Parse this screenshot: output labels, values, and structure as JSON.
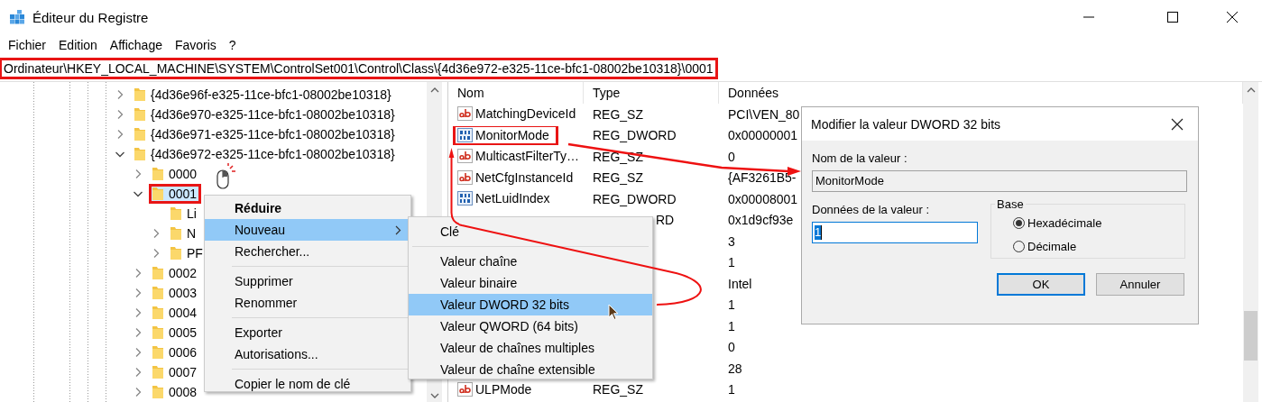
{
  "window": {
    "title": "Éditeur du Registre"
  },
  "menu": [
    "Fichier",
    "Edition",
    "Affichage",
    "Favoris",
    "?"
  ],
  "address": {
    "path": "Ordinateur\\HKEY_LOCAL_MACHINE\\SYSTEM\\ControlSet001\\Control\\Class\\{4d36e972-e325-11ce-bfc1-08002be10318}\\0001",
    "annotated": true
  },
  "tree": [
    {
      "kind": "key",
      "label": "{4d36e96f-e325-11ce-bfc1-08002be10318}",
      "expanded": false,
      "selected": false,
      "annotated": false
    },
    {
      "kind": "key",
      "label": "{4d36e970-e325-11ce-bfc1-08002be10318}",
      "expanded": false,
      "selected": false,
      "annotated": false
    },
    {
      "kind": "key",
      "label": "{4d36e971-e325-11ce-bfc1-08002be10318}",
      "expanded": false,
      "selected": false,
      "annotated": false
    },
    {
      "kind": "key",
      "label": "{4d36e972-e325-11ce-bfc1-08002be10318}",
      "expanded": true,
      "selected": false,
      "annotated": false,
      "children": [
        {
          "kind": "key",
          "label": "0000",
          "expanded": false,
          "selected": false,
          "annotated": false
        },
        {
          "kind": "key",
          "label": "0001",
          "expanded": true,
          "selected": true,
          "annotated": true,
          "children": [
            {
              "kind": "leaf",
              "label": "Li",
              "selected": false,
              "annotated": false
            },
            {
              "kind": "key",
              "label": "N",
              "expanded": false,
              "selected": false,
              "annotated": false
            },
            {
              "kind": "key",
              "label": "PF",
              "expanded": false,
              "selected": false,
              "annotated": false
            }
          ]
        },
        {
          "kind": "key",
          "label": "0002",
          "expanded": false,
          "selected": false,
          "annotated": false
        },
        {
          "kind": "key",
          "label": "0003",
          "expanded": false,
          "selected": false,
          "annotated": false
        },
        {
          "kind": "key",
          "label": "0004",
          "expanded": false,
          "selected": false,
          "annotated": false
        },
        {
          "kind": "key",
          "label": "0005",
          "expanded": false,
          "selected": false,
          "annotated": false
        },
        {
          "kind": "key",
          "label": "0006",
          "expanded": false,
          "selected": false,
          "annotated": false
        },
        {
          "kind": "key",
          "label": "0007",
          "expanded": false,
          "selected": false,
          "annotated": false
        },
        {
          "kind": "key",
          "label": "0008",
          "expanded": false,
          "selected": false,
          "annotated": false
        }
      ]
    }
  ],
  "table": {
    "columns": [
      "Nom",
      "Type",
      "Données"
    ],
    "rows": [
      {
        "kind": "sz",
        "name": "MatchingDeviceId",
        "type": "REG_SZ",
        "data": "PCI\\VEN_80",
        "annotated": false
      },
      {
        "kind": "dword",
        "name": "MonitorMode",
        "type": "REG_DWORD",
        "data": "0x00000001",
        "annotated": true
      },
      {
        "kind": "sz",
        "name": "MulticastFilterTy…",
        "type": "REG_SZ",
        "data": "0",
        "annotated": false
      },
      {
        "kind": "sz",
        "name": "NetCfgInstanceId",
        "type": "REG_SZ",
        "data": "{AF3261B5-",
        "annotated": false
      },
      {
        "kind": "dword",
        "name": "NetLuidIndex",
        "type": "REG_DWORD",
        "data": "0x00008001",
        "annotated": false
      },
      {
        "type": "RD",
        "type_tail": true,
        "data": "0x1d9cf93e"
      },
      {
        "data": "3"
      },
      {
        "data": "1"
      },
      {
        "data": "Intel"
      },
      {
        "data": "1"
      },
      {
        "data": "1"
      },
      {
        "data": "0"
      },
      {
        "data": "28"
      },
      {
        "kind": "sz",
        "name": "ULPMode",
        "type": "REG_SZ",
        "data": "1",
        "annotated": false
      }
    ]
  },
  "context_menu": [
    {
      "kind": "item",
      "label": "Réduire",
      "default": true,
      "selected": false,
      "submenu": false
    },
    {
      "kind": "item",
      "label": "Nouveau",
      "default": false,
      "selected": true,
      "submenu": true
    },
    {
      "kind": "item",
      "label": "Rechercher...",
      "default": false,
      "selected": false,
      "submenu": false
    },
    {
      "kind": "separator"
    },
    {
      "kind": "item",
      "label": "Supprimer",
      "default": false,
      "selected": false,
      "submenu": false
    },
    {
      "kind": "item",
      "label": "Renommer",
      "default": false,
      "selected": false,
      "submenu": false
    },
    {
      "kind": "separator"
    },
    {
      "kind": "item",
      "label": "Exporter",
      "default": false,
      "selected": false,
      "submenu": false
    },
    {
      "kind": "item",
      "label": "Autorisations...",
      "default": false,
      "selected": false,
      "submenu": false
    },
    {
      "kind": "separator"
    },
    {
      "kind": "item",
      "label": "Copier le nom de clé",
      "default": false,
      "selected": false,
      "submenu": false
    }
  ],
  "submenu": [
    {
      "kind": "item",
      "label": "Clé",
      "selected": false
    },
    {
      "kind": "separator"
    },
    {
      "kind": "item",
      "label": "Valeur chaîne",
      "selected": false
    },
    {
      "kind": "item",
      "label": "Valeur binaire",
      "selected": false
    },
    {
      "kind": "item",
      "label": "Valeur DWORD 32 bits",
      "selected": true
    },
    {
      "kind": "item",
      "label": "Valeur QWORD (64 bits)",
      "selected": false
    },
    {
      "kind": "item",
      "label": "Valeur de chaînes multiples",
      "selected": false
    },
    {
      "kind": "item",
      "label": "Valeur de chaîne extensible",
      "selected": false
    }
  ],
  "dialog": {
    "title": "Modifier la valeur DWORD 32 bits",
    "name_label": "Nom de la valeur :",
    "name_value": "MonitorMode",
    "data_label": "Données de la valeur :",
    "data_value": "1",
    "value_selected": true,
    "base": {
      "title": "Base",
      "options": [
        {
          "label": "Hexadécimale",
          "selected": true
        },
        {
          "label": "Décimale",
          "selected": false
        }
      ]
    },
    "buttons": [
      {
        "label": "OK",
        "default": true
      },
      {
        "label": "Annuler",
        "default": false
      }
    ]
  }
}
